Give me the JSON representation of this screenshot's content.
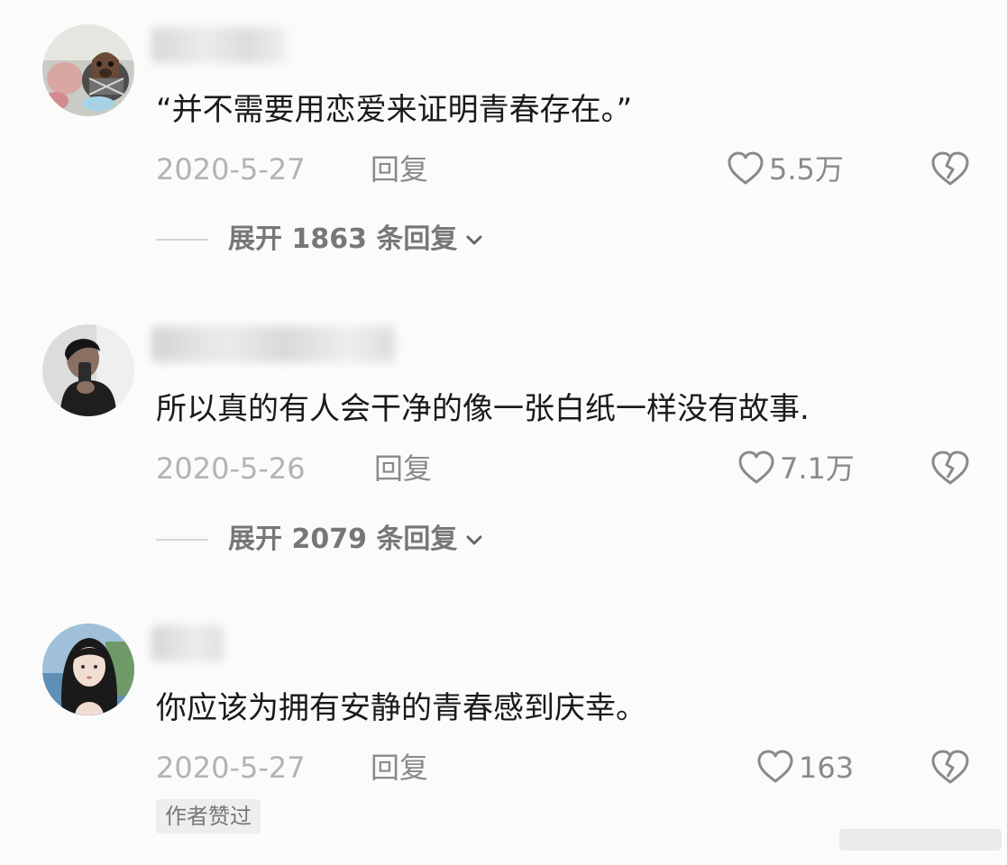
{
  "comments": [
    {
      "text": "“并不需要用恋爱来证明青春存在。”",
      "date": "2020-5-27",
      "reply_label": "回复",
      "likes": "5.5万",
      "expand_label": "展开 1863 条回复"
    },
    {
      "text": "所以真的有人会干净的像一张白纸一样没有故事.",
      "date": "2020-5-26",
      "reply_label": "回复",
      "likes": "7.1万",
      "expand_label": "展开 2079 条回复"
    },
    {
      "text": "你应该为拥有安静的青春感到庆幸。",
      "date": "2020-5-27",
      "reply_label": "回复",
      "likes": "163",
      "badge": "作者赞过"
    }
  ],
  "colors": {
    "background": "#fbfbfb",
    "text": "#1a1a1a",
    "meta_gray": "#b3b3b3",
    "action_gray": "#8a8a8a"
  },
  "icons": {
    "like": "heart-outline-icon",
    "dislike": "broken-heart-icon",
    "expand": "chevron-down-icon"
  }
}
